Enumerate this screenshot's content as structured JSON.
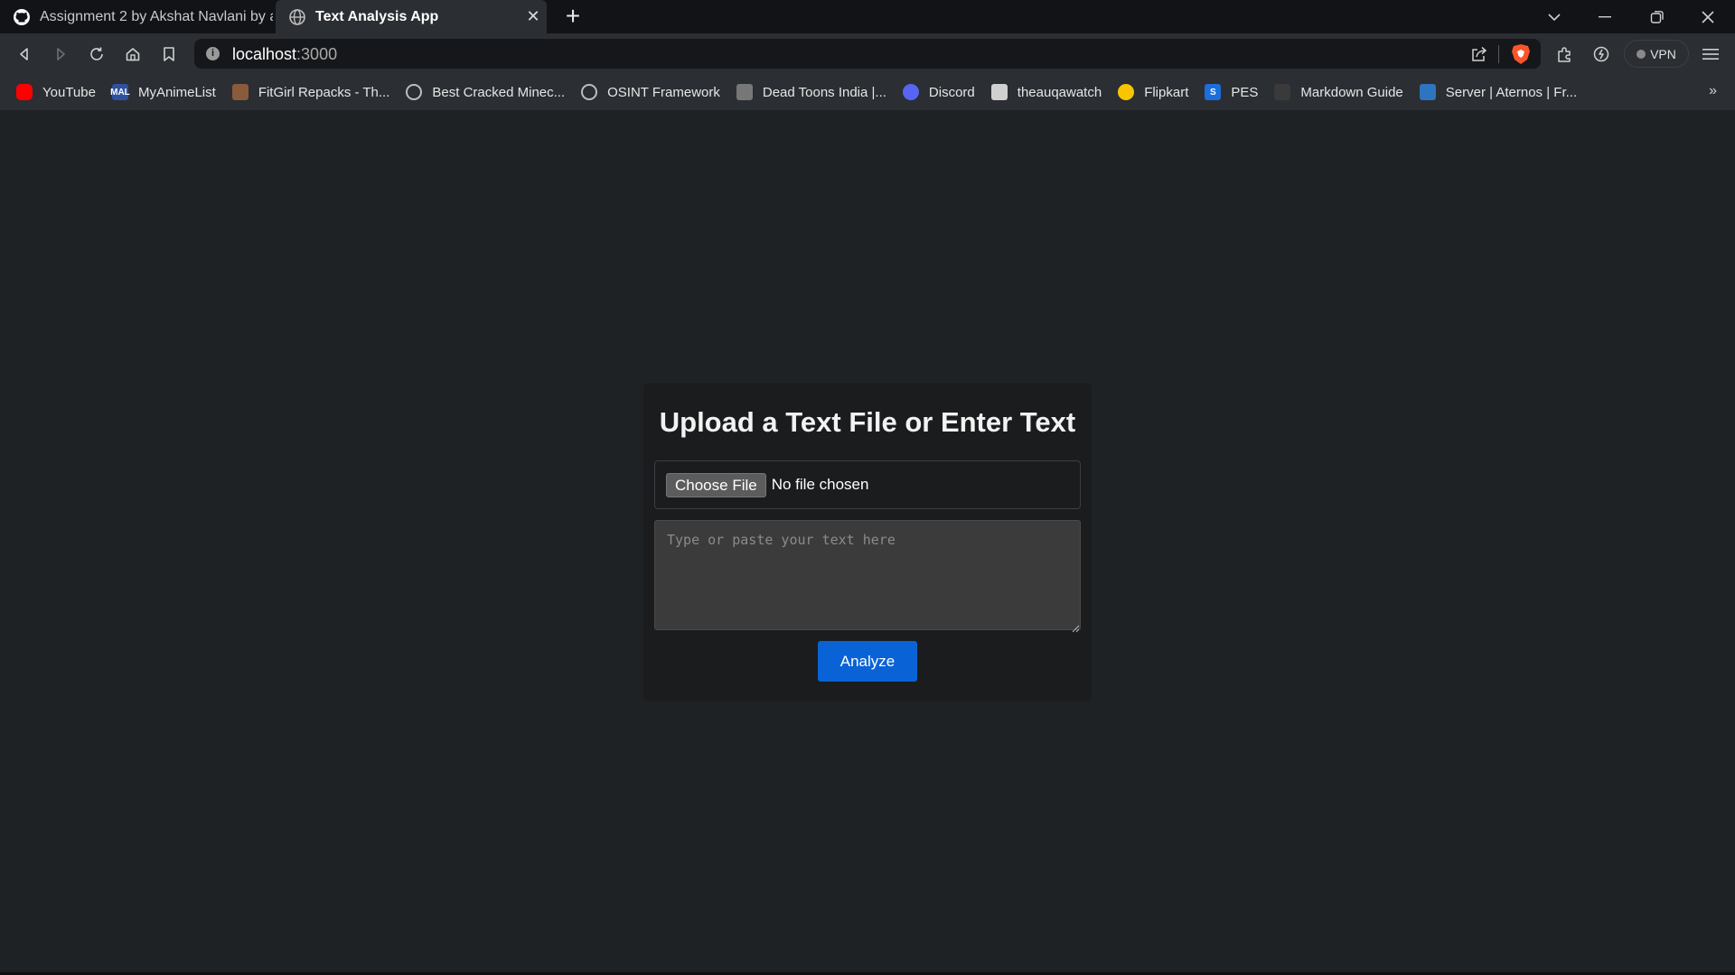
{
  "browser": {
    "tabs": [
      {
        "title": "Assignment 2 by Akshat Navlani by ak",
        "icon": "github-icon",
        "active": false
      },
      {
        "title": "Text Analysis App",
        "icon": "globe-icon",
        "active": true,
        "close": "✕"
      }
    ],
    "new_tab": "+",
    "url": {
      "host": "localhost",
      "port": ":3000"
    },
    "vpn_label": "VPN",
    "bookmarks": [
      {
        "label": "YouTube",
        "icon": "youtube-icon",
        "color": "#ff0000"
      },
      {
        "label": "MyAnimeList",
        "icon": "myanimelist-icon",
        "color": "#2e51a2",
        "icon_text": "MAL"
      },
      {
        "label": "FitGirl Repacks - Th...",
        "icon": "fitgirl-icon",
        "color": "#8a5a3c"
      },
      {
        "label": "Best Cracked Minec...",
        "icon": "globe-icon",
        "color": "#bdbdbd"
      },
      {
        "label": "OSINT Framework",
        "icon": "globe-icon",
        "color": "#bdbdbd"
      },
      {
        "label": "Dead Toons India |...",
        "icon": "deadtoons-icon",
        "color": "#777777"
      },
      {
        "label": "Discord",
        "icon": "discord-icon",
        "color": "#5865f2"
      },
      {
        "label": "theauqawatch",
        "icon": "theauqawatch-icon",
        "color": "#d0d0d0"
      },
      {
        "label": "Flipkart",
        "icon": "flipkart-icon",
        "color": "#f7c600"
      },
      {
        "label": "PES",
        "icon": "pes-icon",
        "color": "#1d6ed8",
        "icon_text": "S"
      },
      {
        "label": "Markdown Guide",
        "icon": "markdown-icon",
        "color": "#3a3a3a"
      },
      {
        "label": "Server | Aternos | Fr...",
        "icon": "aternos-icon",
        "color": "#2f74c0"
      }
    ],
    "bookmarks_more": "»"
  },
  "page": {
    "heading": "Upload a Text File or Enter Text",
    "file_button": "Choose File",
    "file_status": "No file chosen",
    "textarea_placeholder": "Type or paste your text here",
    "analyze_button": "Analyze",
    "accent_color": "#0a63d6"
  }
}
